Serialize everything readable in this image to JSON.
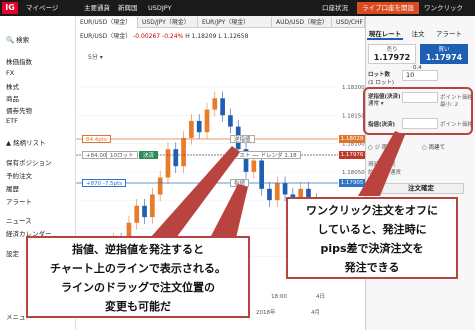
{
  "topnav": {
    "logo": "IG",
    "mypage": "マイページ",
    "items": [
      "主要通貨",
      "新興国",
      "USDJPY"
    ],
    "account": "口座状況",
    "live_button": "ライブ口座を開設",
    "oneclick": "ワンクリック"
  },
  "sidebar": {
    "items": [
      "検索",
      "株価指数",
      "FX",
      "株式",
      "商品",
      "債券先物",
      "ETF",
      "▲ 銘柄リスト",
      "保有ポジション",
      "予約注文",
      "履歴",
      "アラート",
      "ニュース",
      "経済カレンダー",
      "設定",
      "メニュー"
    ]
  },
  "tabs": [
    "EUR/USD（現金）",
    "USD/JPY（現金）",
    "EUR/JPY（現金）",
    "AUD/USD（現金）",
    "USD/CHF"
  ],
  "chart": {
    "title": "EUR/USD（現金）",
    "change": "-0.00267",
    "change_pct": "-0.24%",
    "hl": "H 1.18209 L 1.12658",
    "timeframe": "5分",
    "order_labels": {
      "upper": "84.4pts",
      "upper_action": "逆指値",
      "mid_left": "+84.00",
      "mid_size": "10ロット",
      "mid_close": "決済",
      "mid_line": "リスト ── ドレンダ 1.18",
      "lower": "+870 -7.5pts",
      "lower_action": "指値"
    },
    "price_tags": [
      "1.18029",
      "1.17976",
      "1.17905"
    ],
    "ytick_labels": [
      "1.18200",
      "1.18150",
      "1.18100",
      "1.18050",
      "1.18000",
      "1.17950",
      "1.17900"
    ],
    "bottom_time": [
      "18:00",
      "4日"
    ],
    "bottom_year": "2018年",
    "bottom_month": "4月"
  },
  "chart_data": {
    "type": "line",
    "title": "EUR/USD（現金）",
    "y_ticks": [
      1.182,
      1.1815,
      1.181,
      1.1805,
      1.18,
      1.1795,
      1.179
    ],
    "ylim": [
      1.1785,
      1.1823
    ],
    "x": [
      0,
      1,
      2,
      3,
      4,
      5,
      6,
      7,
      8,
      9,
      10,
      11,
      12,
      13,
      14,
      15,
      16,
      17,
      18,
      19,
      20,
      21,
      22,
      23,
      24,
      25,
      26,
      27,
      28,
      29,
      30
    ],
    "series": [
      {
        "values": [
          1.1788,
          1.1787,
          1.179,
          1.1793,
          1.1792,
          1.1796,
          1.1799,
          1.1797,
          1.1801,
          1.1804,
          1.1809,
          1.1806,
          1.1811,
          1.1814,
          1.1812,
          1.1816,
          1.1818,
          1.1815,
          1.1813,
          1.1809,
          1.1805,
          1.1807,
          1.1802,
          1.18,
          1.1803,
          1.1801,
          1.1799,
          1.1802,
          1.18,
          1.1799,
          1.1798
        ]
      }
    ]
  },
  "rpanel": {
    "tabs": [
      "現在レート",
      "注文",
      "アラート"
    ],
    "sell_label": "売り",
    "sell_price": "1.17972",
    "buy_label": "買い",
    "buy_price": "1.17974",
    "spread": "0.4",
    "lot_label": "ロット数",
    "lot_unit": "(1 ロット)",
    "lot_value": "10",
    "stop_label": "逆指値(決済)",
    "stop_sub": "通常 ▾",
    "stop_side": "ポイント価格 ▾",
    "stop_min": "最小: 2",
    "limit_label": "指値(決済)",
    "limit_side": "ポイント価格 ▾",
    "radio1": "ジ 両建て",
    "radio2": "両建て",
    "info1": "現時点状況",
    "info2": "約定後の通貨",
    "confirm": "注文確定"
  },
  "callouts": {
    "left": [
      "指値、逆指値を発注すると",
      "チャート上のラインで表示される。",
      "ラインのドラッグで注文位置の",
      "変更も可能だ"
    ],
    "right": [
      "ワンクリック注文をオフに",
      "していると、発注時に",
      "pips差で決済注文を",
      "発注できる"
    ]
  },
  "colors": {
    "accent": "#b8433f",
    "price_up": "#e87c2a",
    "price_down": "#1e5fb3",
    "live": "#d94a1e",
    "buy": "#1e5fb3",
    "stop_line": "#e0752f",
    "limit_line": "#2e73c8"
  }
}
